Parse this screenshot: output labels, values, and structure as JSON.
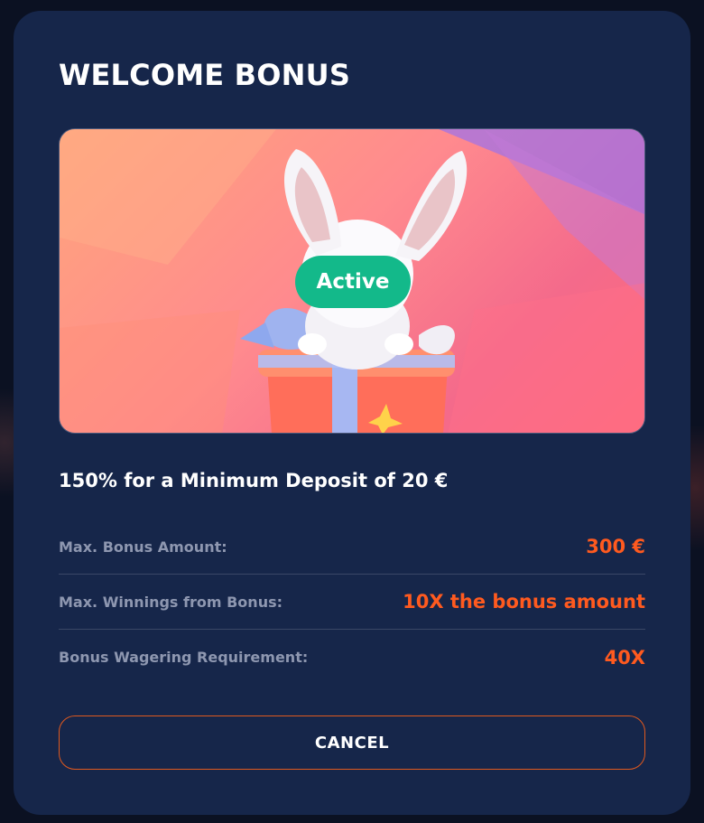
{
  "modal": {
    "title": "WELCOME BONUS",
    "badge": "Active",
    "offer": "150% for a Minimum Deposit of 20 €",
    "details": [
      {
        "label": "Max. Bonus Amount:",
        "value": "300 €"
      },
      {
        "label": "Max. Winnings from Bonus:",
        "value": "10X the bonus amount"
      },
      {
        "label": "Bonus Wagering Requirement:",
        "value": "40X"
      }
    ],
    "cancel_label": "CANCEL"
  },
  "colors": {
    "modal_bg": "#16264a",
    "accent_orange": "#ff5a1f",
    "badge_green": "#13b98a",
    "label_gray": "#8e97b0"
  },
  "icons": {
    "banner_art": "fox-with-gift-illustration"
  }
}
